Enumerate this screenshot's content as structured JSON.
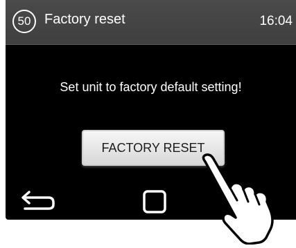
{
  "header": {
    "step_number": "50",
    "title": "Factory reset",
    "time": "16:04"
  },
  "main": {
    "message": "Set unit to factory default setting!",
    "reset_button_label": "FACTORY RESET"
  },
  "nav": {
    "back_icon": "back-arrow-icon",
    "home_icon": "home-square-icon"
  },
  "overlay": {
    "pointer_icon": "pointing-hand-icon"
  }
}
